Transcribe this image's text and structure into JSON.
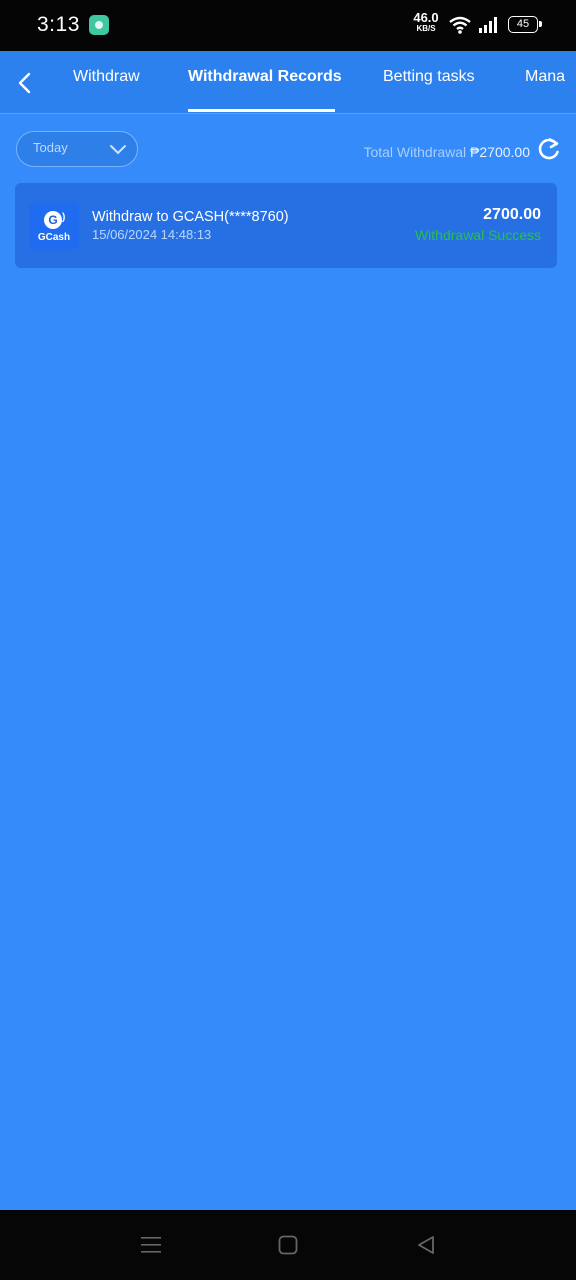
{
  "status_bar": {
    "time": "3:13",
    "net_speed": "46.0",
    "net_speed_unit": "KB/S",
    "battery": "45"
  },
  "tabs": [
    {
      "label": "Withdraw",
      "active": false
    },
    {
      "label": "Withdrawal Records",
      "active": true
    },
    {
      "label": "Betting tasks",
      "active": false
    },
    {
      "label": "Mana",
      "active": false
    }
  ],
  "filter": {
    "date_range": "Today"
  },
  "summary": {
    "total_label": "Total Withdrawal",
    "total_amount": "₱2700.00"
  },
  "records": [
    {
      "logo_text": "GCash",
      "logo_letter": "G",
      "title": "Withdraw to GCASH(****8760)",
      "datetime": "15/06/2024 14:48:13",
      "amount": "2700.00",
      "status": "Withdrawal Success"
    }
  ],
  "colors": {
    "background": "#358bf9",
    "tabbar": "#2d81ee",
    "card": "#2770e4",
    "success": "#27c04a"
  }
}
